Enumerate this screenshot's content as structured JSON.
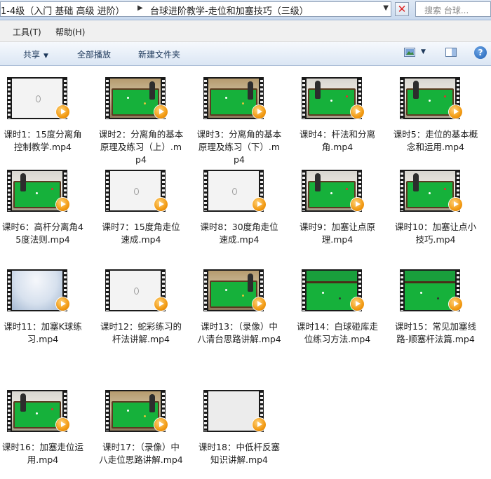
{
  "address_bar": {
    "crumb_parent": "1-4级（入门 基础 高级 进阶）",
    "crumb_current": "台球进阶教学-走位和加塞技巧（三级）",
    "search_placeholder": "搜索 台球..."
  },
  "menu": [
    "工具(T)",
    "帮助(H)"
  ],
  "toolbar": {
    "share_label": "共享",
    "play_all_label": "全部播放",
    "new_folder_label": "新建文件夹"
  },
  "files": [
    {
      "name": "课时1：15度分离角控制教学.mp4",
      "scene": "white"
    },
    {
      "name": "课时2：分离角的基本原理及练习（上）.mp4",
      "scene": "table"
    },
    {
      "name": "课时3：分离角的基本原理及练习（下）.mp4",
      "scene": "table"
    },
    {
      "name": "课时4：杆法和分离角.mp4",
      "scene": "table-player"
    },
    {
      "name": "课时5：走位的基本概念和运用.mp4",
      "scene": "table-player"
    },
    {
      "name": "课时6：高杆分离角45度法则.mp4",
      "scene": "table-player"
    },
    {
      "name": "课时7：15度角走位速成.mp4",
      "scene": "white"
    },
    {
      "name": "课时8：30度角走位速成.mp4",
      "scene": "white"
    },
    {
      "name": "课时9：加塞让点原理.mp4",
      "scene": "table-player"
    },
    {
      "name": "课时10：加塞让点小技巧.mp4",
      "scene": "table-player"
    },
    {
      "name": "课时11：加塞K球练习.mp4",
      "scene": "blue"
    },
    {
      "name": "课时12：蛇彩练习的杆法讲解.mp4",
      "scene": "white"
    },
    {
      "name": "课时13：（录像）中八清台思路讲解.mp4",
      "scene": "table"
    },
    {
      "name": "课时14：白球碰库走位练习方法.mp4",
      "scene": "green"
    },
    {
      "name": "课时15：常见加塞线路-顺塞杆法篇.mp4",
      "scene": "green"
    },
    {
      "name": "课时16：加塞走位运用.mp4",
      "scene": "table-player"
    },
    {
      "name": "课时17：（录像）中八走位思路讲解.mp4",
      "scene": "table"
    },
    {
      "name": "课时18：中低杆反塞知识讲解.mp4",
      "scene": "grey"
    }
  ]
}
